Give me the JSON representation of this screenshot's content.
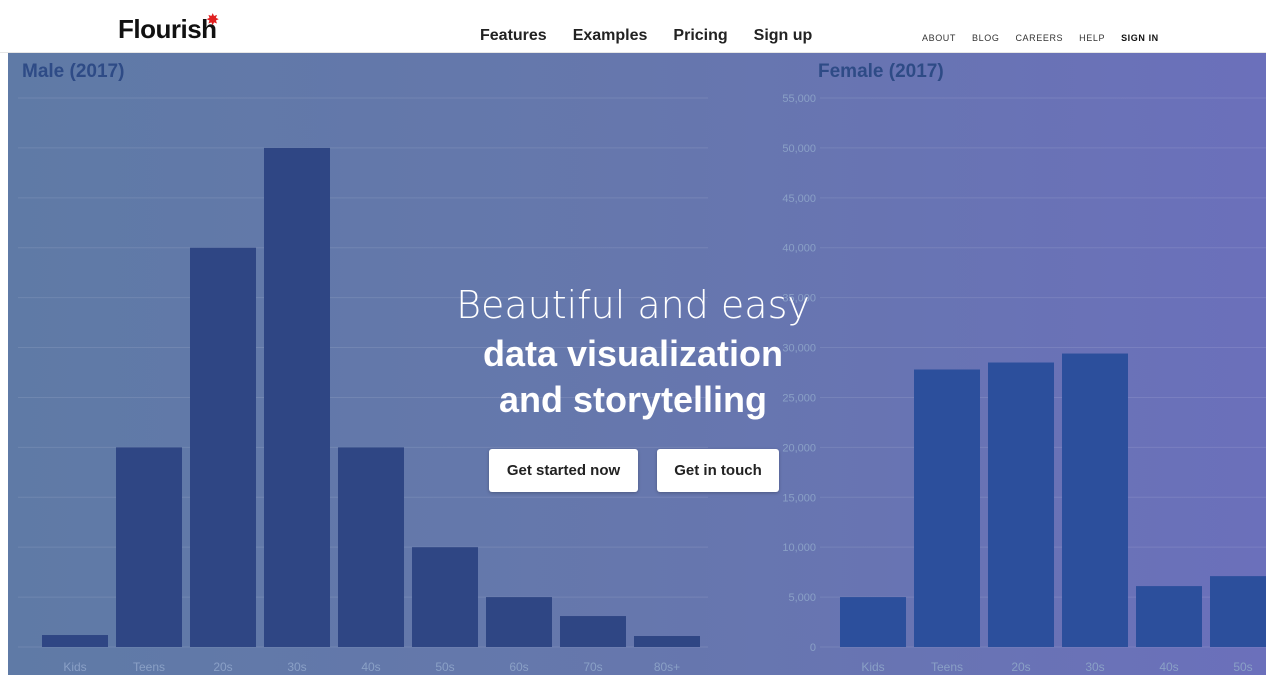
{
  "header": {
    "logo_text": "Flourish",
    "logo_mark": "✸",
    "main_nav": [
      "Features",
      "Examples",
      "Pricing",
      "Sign up"
    ],
    "sub_nav": [
      "ABOUT",
      "BLOG",
      "CAREERS",
      "HELP",
      "SIGN IN"
    ]
  },
  "hero": {
    "line1": "Beautiful and easy",
    "line2": "data visualization",
    "line3": "and storytelling",
    "cta_primary": "Get started now",
    "cta_secondary": "Get in touch"
  },
  "colors": {
    "bar_male": "#2f4684",
    "bar_female": "#2c4f9c",
    "accent_logo": "#e02020"
  },
  "chart_data": [
    {
      "type": "bar",
      "title": "Male (2017)",
      "categories": [
        "Kids",
        "Teens",
        "20s",
        "30s",
        "40s",
        "50s",
        "60s",
        "70s",
        "80s+"
      ],
      "values": [
        1200,
        20000,
        40000,
        50000,
        20000,
        10000,
        5000,
        3100,
        1100
      ],
      "ylim": [
        0,
        55000
      ],
      "grid": true
    },
    {
      "type": "bar",
      "title": "Female (2017)",
      "categories": [
        "Kids",
        "Teens",
        "20s",
        "30s",
        "40s",
        "50s"
      ],
      "values": [
        5000,
        27800,
        28500,
        29400,
        6100,
        7100
      ],
      "yticks": [
        "0",
        "5,000",
        "10,000",
        "15,000",
        "20,000",
        "25,000",
        "30,000",
        "35,000",
        "40,000",
        "45,000",
        "50,000",
        "55,000"
      ],
      "ylim": [
        0,
        55000
      ],
      "grid": true
    }
  ]
}
